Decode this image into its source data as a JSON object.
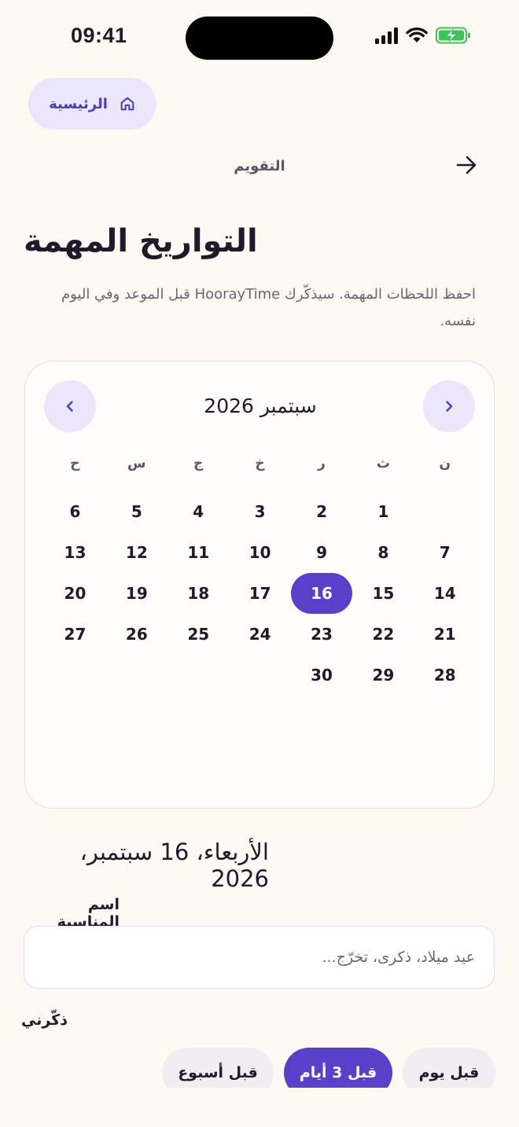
{
  "status_bar": {
    "time": "09:41"
  },
  "header": {
    "home_label": "الرئيسية",
    "nav_title": "التقويم"
  },
  "page": {
    "title": "التواريخ المهمة",
    "subtitle": "احفظ اللحظات المهمة. سيذكّرك HoorayTime قبل الموعد وفي اليوم نفسه."
  },
  "calendar": {
    "month_label": "سبتمبر 2026",
    "weekdays": [
      "ن",
      "ث",
      "ر",
      "خ",
      "ج",
      "س",
      "ح"
    ],
    "leading_blanks": 1,
    "days_in_month": 30,
    "selected_day": 16
  },
  "event": {
    "selected_date_label": "الأربعاء، 16 سبتمبر، 2026",
    "name_label": "اسم المناسبة",
    "name_value": "",
    "name_placeholder": "عيد ميلاد، ذكرى، تخرّج..."
  },
  "reminder": {
    "label": "ذكّرني",
    "options": [
      {
        "label": "قبل يوم",
        "active": false
      },
      {
        "label": "قبل 3 أيام",
        "active": true
      },
      {
        "label": "قبل أسبوع",
        "active": false
      }
    ]
  },
  "colors": {
    "accent": "#5841C8",
    "accent_soft": "#EBE6FA",
    "background": "#FFF9F3"
  },
  "icons": {
    "home": "home-icon",
    "back": "arrow-right-icon",
    "prev": "chevron-left-icon",
    "next": "chevron-right-icon"
  }
}
